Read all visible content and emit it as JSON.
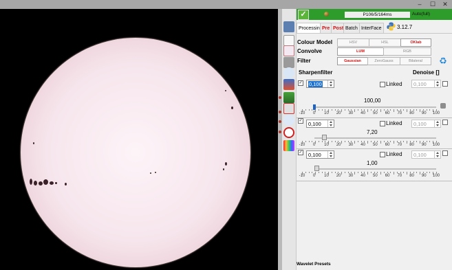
{
  "window": {
    "minimize": "–",
    "maximize": "☐",
    "close": "✕"
  },
  "status": {
    "ok_icon": "check-icon",
    "timing": "P106/5/164ms",
    "mode": "Auto(full)"
  },
  "tabs": [
    {
      "label": "Processing",
      "active": true
    },
    {
      "label": "Pre",
      "red": true
    },
    {
      "label": "Post",
      "red": true
    },
    {
      "label": "Batch"
    },
    {
      "label": "InterFace"
    }
  ],
  "python_version": "3.12.7",
  "colour_model": {
    "label": "Colour Model",
    "options": [
      "HSV",
      "HSL",
      "OKlab"
    ],
    "selected": "OKlab"
  },
  "convolve": {
    "label": "Convolve",
    "options": [
      "LUM",
      "RGB"
    ],
    "selected": "LUM"
  },
  "filter": {
    "label": "Filter",
    "options": [
      "Gaussian",
      "ZeroGauss",
      "Bilateral"
    ],
    "selected": "Gaussian"
  },
  "sharpen_header": "Sharpenfilter",
  "denoise_header": "Denoise []",
  "bands": [
    {
      "value": "0,100",
      "linked_label": "Linked",
      "denoise": "0,100",
      "gain": "100,00",
      "gain_level": 0.0
    },
    {
      "value": "0,100",
      "linked_label": "Linked",
      "denoise": "0,100",
      "gain": "7,20",
      "gain_level": 0.073
    },
    {
      "value": "0,100",
      "linked_label": "Linked",
      "denoise": "0,100",
      "gain": "1,00",
      "gain_level": 0.01
    }
  ],
  "scale_labels": [
    "-10",
    "0",
    "10",
    "20",
    "30",
    "40",
    "50",
    "60",
    "70",
    "80",
    "90",
    "100"
  ],
  "wavelet_presets": "Wavelet Presets",
  "colors": {
    "accent_green": "#2e9c2a",
    "selected_red": "#d01010",
    "sun": "#f6e5ec"
  }
}
